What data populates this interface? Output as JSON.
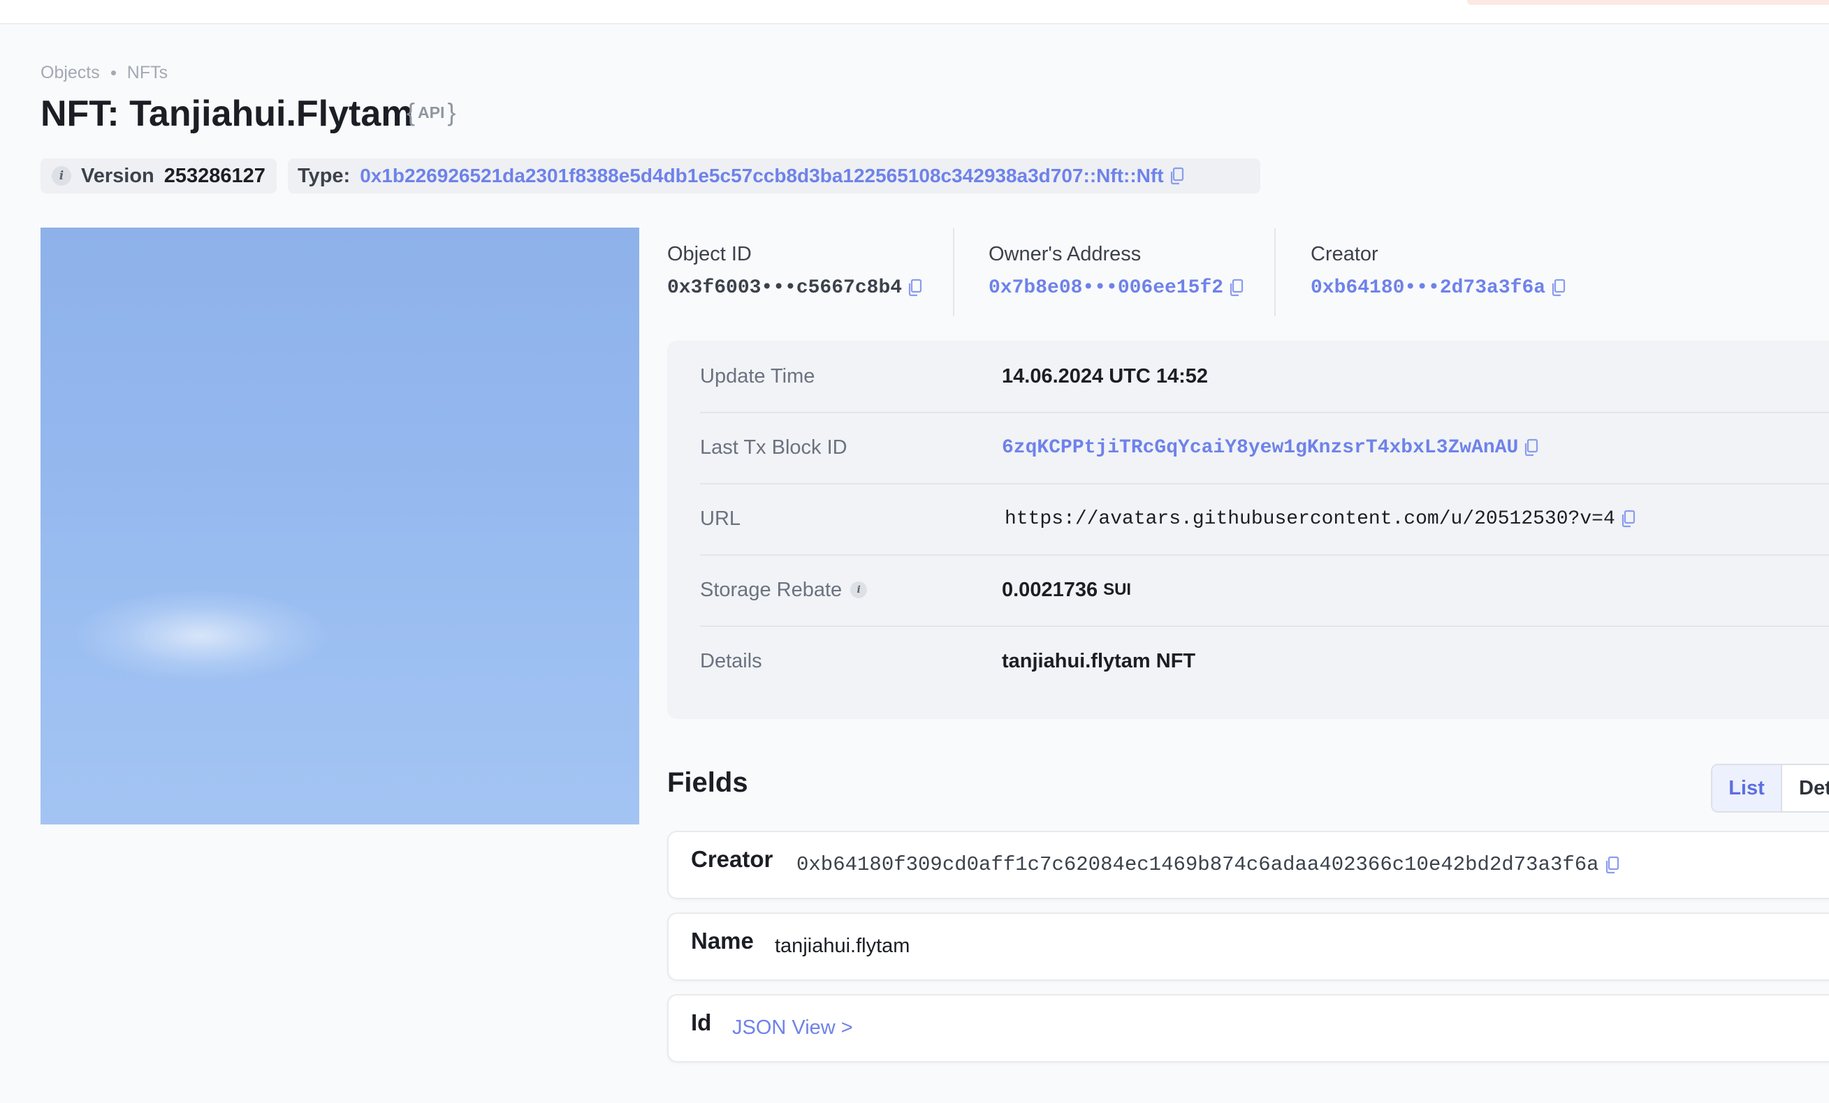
{
  "breadcrumb": {
    "items": [
      "Objects",
      "NFTs"
    ]
  },
  "page": {
    "title": "NFT: Tanjiahui.Flytam",
    "api_badge": "API"
  },
  "version": {
    "label": "Version",
    "value": "253286127"
  },
  "type": {
    "label": "Type:",
    "value": "0x1b226926521da2301f8388e5d4db1e5c57ccb8d3ba122565108c342938a3d707::Nft::Nft"
  },
  "meta": {
    "object_id": {
      "label": "Object ID",
      "value": "0x3f6003•••c5667c8b4"
    },
    "owner": {
      "label": "Owner's Address",
      "value": "0x7b8e08•••006ee15f2"
    },
    "creator": {
      "label": "Creator",
      "value": "0xb64180•••2d73a3f6a"
    }
  },
  "details": {
    "update_time": {
      "label": "Update Time",
      "value": "14.06.2024 UTC 14:52"
    },
    "last_tx": {
      "label": "Last Tx Block ID",
      "value": "6zqKCPPtjiTRcGqYcaiY8yew1gKnzsrT4xbxL3ZwAnAU"
    },
    "url": {
      "label": "URL",
      "value": "https://avatars.githubusercontent.com/u/20512530?v=4"
    },
    "storage_rebate": {
      "label": "Storage Rebate",
      "value": "0.0021736",
      "unit": "SUI"
    },
    "details": {
      "label": "Details",
      "value": "tanjiahui.flytam NFT"
    }
  },
  "fields": {
    "title": "Fields",
    "toggle": {
      "list": "List",
      "detail": "Det"
    },
    "items": [
      {
        "key": "Creator",
        "value": "0xb64180f309cd0aff1c7c62084ec1469b874c6adaa402366c10e42bd2d73a3f6a"
      },
      {
        "key": "Name",
        "value": "tanjiahui.flytam"
      },
      {
        "key": "Id",
        "value": "JSON View >"
      }
    ]
  },
  "colors": {
    "accent": "#6e82ea",
    "background": "#f9fafb",
    "card": "#f1f3f6"
  },
  "icons": {
    "copy": "copy-icon",
    "info": "info-icon"
  }
}
